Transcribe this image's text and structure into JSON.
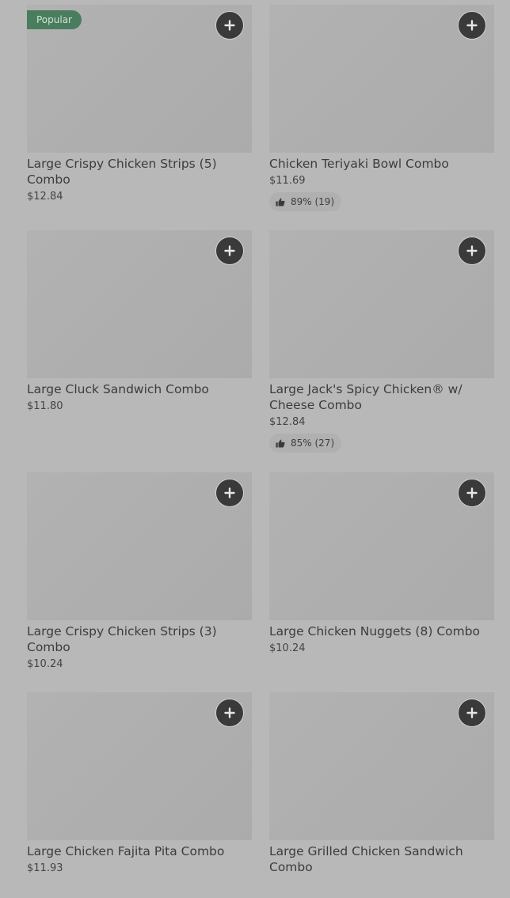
{
  "colors": {
    "background": "#b8b8b8",
    "thumbnail": "#aeaeae",
    "add_button": "#3a3a3a",
    "popular_badge": "#4a7d5d",
    "rating_pill": "#b0b0b0"
  },
  "icons": {
    "add": "plus-icon",
    "rating": "thumbs-up-icon"
  },
  "items": [
    {
      "badge": "Popular",
      "name": "Large Crispy Chicken Strips (5) Combo",
      "price": "$12.84",
      "rating": ""
    },
    {
      "badge": "",
      "name": "Chicken Teriyaki Bowl Combo",
      "price": "$11.69",
      "rating": "89% (19)"
    },
    {
      "badge": "",
      "name": "Large Cluck Sandwich Combo",
      "price": "$11.80",
      "rating": ""
    },
    {
      "badge": "",
      "name": "Large Jack's Spicy Chicken® w/ Cheese Combo",
      "price": "$12.84",
      "rating": "85% (27)"
    },
    {
      "badge": "",
      "name": "Large Crispy Chicken Strips (3) Combo",
      "price": "$10.24",
      "rating": ""
    },
    {
      "badge": "",
      "name": "Large Chicken Nuggets (8) Combo",
      "price": "$10.24",
      "rating": ""
    },
    {
      "badge": "",
      "name": "Large Chicken Fajita Pita Combo",
      "price": "$11.93",
      "rating": ""
    },
    {
      "badge": "",
      "name": "Large Grilled Chicken Sandwich Combo",
      "price": "",
      "rating": ""
    }
  ]
}
